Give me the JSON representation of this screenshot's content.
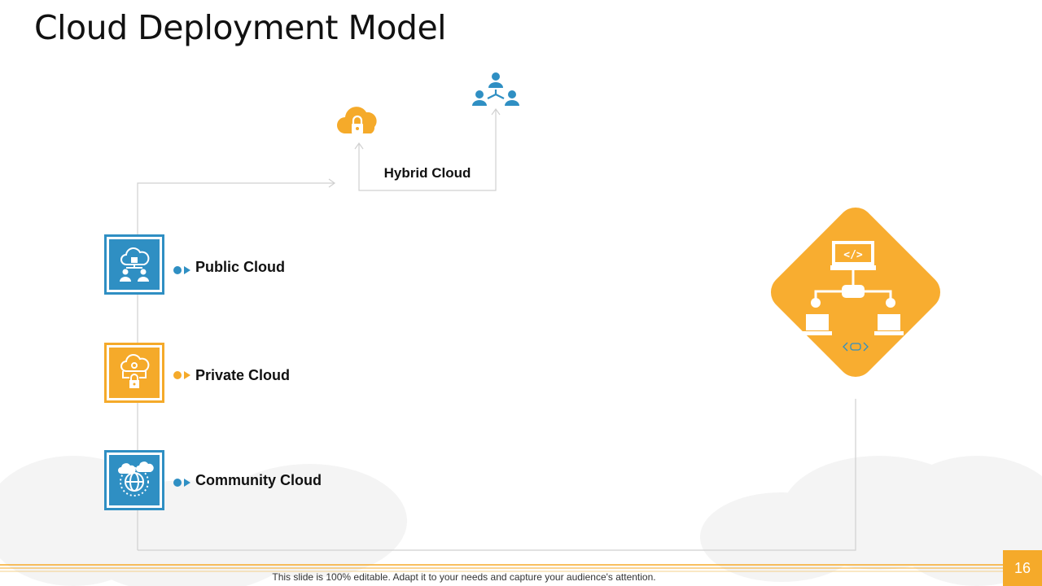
{
  "slide": {
    "title": "Cloud Deployment Model",
    "footer_text": "This slide is 100% editable. Adapt it to your needs and capture your audience's attention.",
    "page_number": "16"
  },
  "hybrid": {
    "label": "Hybrid Cloud",
    "icons": [
      "cloud-lock-icon",
      "network-users-icon"
    ]
  },
  "models": [
    {
      "label": "Public Cloud",
      "icon": "cloud-users-icon",
      "color": "#2f8fc3"
    },
    {
      "label": "Private Cloud",
      "icon": "cloud-gear-lock-icon",
      "color": "#f5aa2a"
    },
    {
      "label": "Community Cloud",
      "icon": "globe-cloud-icon",
      "color": "#2f8fc3"
    }
  ],
  "diamond": {
    "icon": "network-computers-icon",
    "color": "#f8ad30",
    "code_icon_color": "#2f8fc3"
  },
  "colors": {
    "accent_blue": "#2f8fc3",
    "accent_orange": "#f5aa2a",
    "connector_gray": "#d0d0d0"
  }
}
